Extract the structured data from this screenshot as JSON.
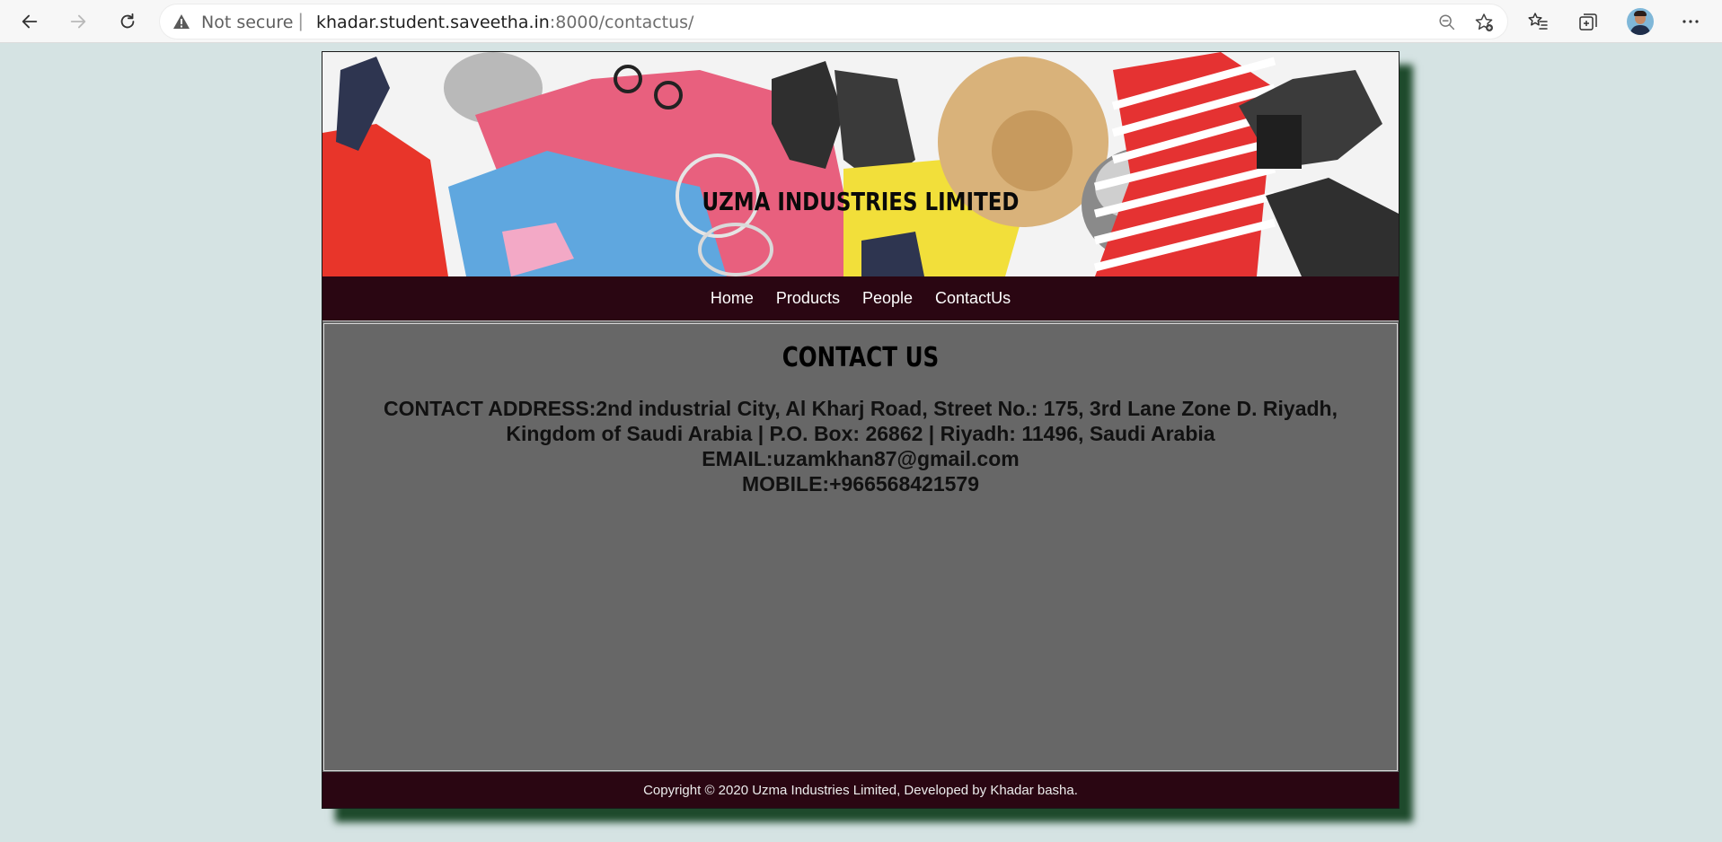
{
  "browser": {
    "security_label": "Not secure",
    "url_host": "khadar.student.saveetha.in",
    "url_rest": ":8000/contactus/",
    "icons": [
      "back-icon",
      "forward-icon",
      "refresh-icon",
      "warning-icon",
      "zoom-out-icon",
      "add-favorite-icon",
      "favorites-icon",
      "collections-icon",
      "profile-avatar",
      "more-icon"
    ]
  },
  "header": {
    "title": "UZMA INDUSTRIES LIMITED"
  },
  "nav": {
    "items": [
      {
        "label": "Home"
      },
      {
        "label": "Products"
      },
      {
        "label": "People"
      },
      {
        "label": "ContactUs"
      }
    ]
  },
  "main": {
    "heading": "CONTACT US",
    "address_line1": "CONTACT ADDRESS:2nd industrial City, Al Kharj Road, Street No.: 175, 3rd Lane Zone D. Riyadh,",
    "address_line2": "Kingdom of Saudi Arabia | P.O. Box: 26862 | Riyadh: 11496, Saudi Arabia",
    "email": "EMAIL:uzamkhan87@gmail.com",
    "mobile": "MOBILE:+966568421579"
  },
  "footer": {
    "text": "Copyright © 2020 Uzma Industries Limited, Developed by Khadar basha."
  },
  "colors": {
    "page_bg": "#d5e3e3",
    "nav_bg": "#2a0612",
    "content_bg": "#676767",
    "shadow": "#1e4a2c"
  }
}
